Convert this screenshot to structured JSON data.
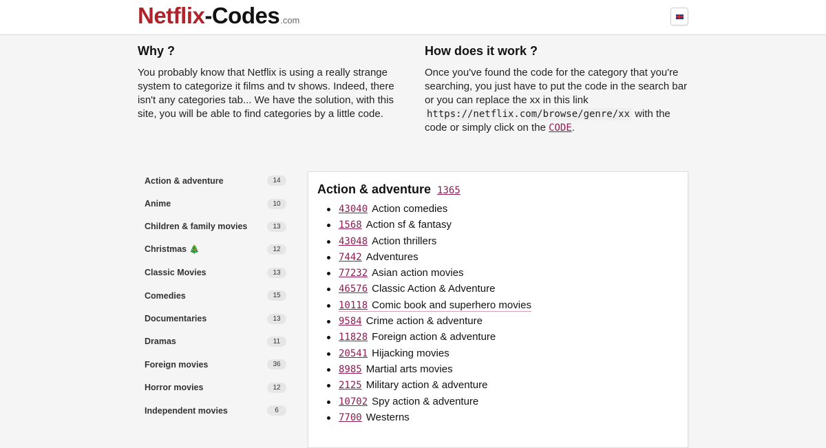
{
  "header": {
    "logo_part1": "Netflix",
    "logo_part2": "-Codes",
    "logo_tld": ".com",
    "language_icon": "uk-flag-icon"
  },
  "why": {
    "title": "Why ?",
    "text": "You probably know that Netflix is using a really strange system to categorize it films and tv shows. Indeed, there isn't any categories tab... We have the solution, with this site, you will be able to find categories by a little code."
  },
  "how": {
    "title": "How does it work ?",
    "text_before": "Once you've found the code for the category that you're searching, you just have to put the code in the search bar or you can replace the xx in this link",
    "link": "https://netflix.com/browse/genre/xx",
    "text_mid": "with the code or simply click on the",
    "code_label": "CODE",
    "text_after": "."
  },
  "categories": [
    {
      "label": "Action & adventure",
      "count": "14"
    },
    {
      "label": "Anime",
      "count": "10"
    },
    {
      "label": "Children & family movies",
      "count": "13"
    },
    {
      "label": "Christmas 🎄",
      "count": "12"
    },
    {
      "label": "Classic Movies",
      "count": "13"
    },
    {
      "label": "Comedies",
      "count": "15"
    },
    {
      "label": "Documentaries",
      "count": "13"
    },
    {
      "label": "Dramas",
      "count": "11"
    },
    {
      "label": "Foreign movies",
      "count": "36"
    },
    {
      "label": "Horror movies",
      "count": "12"
    },
    {
      "label": "Independent movies",
      "count": "6"
    }
  ],
  "panel": {
    "title": "Action & adventure",
    "code": "1365",
    "items": [
      {
        "code": "43040",
        "label": "Action comedies"
      },
      {
        "code": "1568",
        "label": "Action sf & fantasy"
      },
      {
        "code": "43048",
        "label": "Action thrillers"
      },
      {
        "code": "7442",
        "label": "Adventures"
      },
      {
        "code": "77232",
        "label": "Asian action movies"
      },
      {
        "code": "46576",
        "label": "Classic Action & Adventure"
      },
      {
        "code": "10118",
        "label": "Comic book and superhero movies"
      },
      {
        "code": "9584",
        "label": "Crime action & adventure"
      },
      {
        "code": "11828",
        "label": "Foreign action & adventure"
      },
      {
        "code": "20541",
        "label": "Hijacking movies"
      },
      {
        "code": "8985",
        "label": "Martial arts movies"
      },
      {
        "code": "2125",
        "label": "Military action & adventure"
      },
      {
        "code": "10702",
        "label": "Spy action & adventure"
      },
      {
        "code": "7700",
        "label": "Westerns"
      }
    ]
  }
}
